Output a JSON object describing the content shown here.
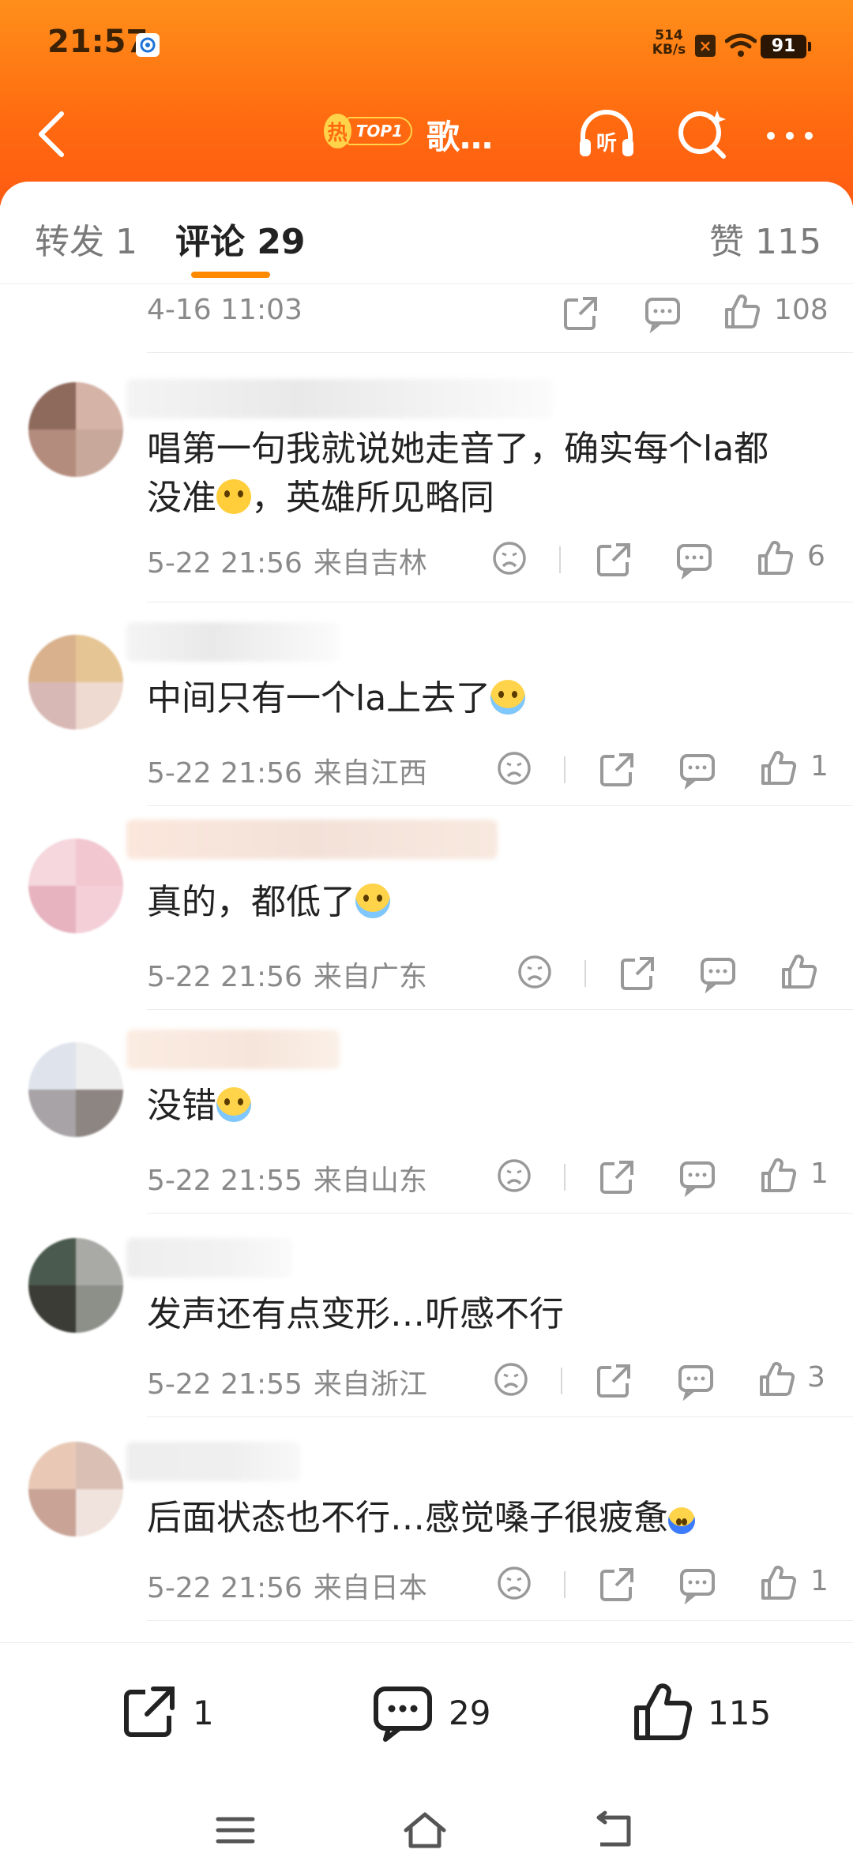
{
  "status_bar": {
    "time": "21:57",
    "speed_value": "514",
    "speed_unit": "KB/s",
    "battery": "91"
  },
  "nav": {
    "hot_badge_char": "热",
    "hot_badge_text": "TOP1",
    "title": "歌…",
    "listen_label": "听"
  },
  "tabs": {
    "repost": "转发 1",
    "comment": "评论 29",
    "like": "赞 115"
  },
  "first_row": {
    "time": "4-16 11:03",
    "likes": "108"
  },
  "comments": [
    {
      "text": "唱第一句我就说她走音了，确实每个la都",
      "text2": "没准",
      "text2_tail": "，英雄所见略同",
      "time": "5-22 21:56",
      "from": "来自吉林",
      "likes": "6"
    },
    {
      "text": "中间只有一个la上去了",
      "time": "5-22 21:56",
      "from": "来自江西",
      "likes": "1"
    },
    {
      "text": "真的，都低了",
      "time": "5-22 21:56",
      "from": "来自广东",
      "likes": ""
    },
    {
      "text": "没错",
      "time": "5-22 21:55",
      "from": "来自山东",
      "likes": "1"
    },
    {
      "text": "发声还有点变形…听感不行",
      "time": "5-22 21:55",
      "from": "来自浙江",
      "likes": "3"
    },
    {
      "text": "后面状态也不行…感觉嗓子很疲惫",
      "time": "5-22 21:56",
      "from": "来自日本",
      "likes": "1"
    }
  ],
  "action_bar": {
    "repost_count": "1",
    "comment_count": "29",
    "like_count": "115"
  },
  "colors": {
    "brand_orange": "#ff6a10",
    "tab_indicator": "#ff8a00"
  }
}
